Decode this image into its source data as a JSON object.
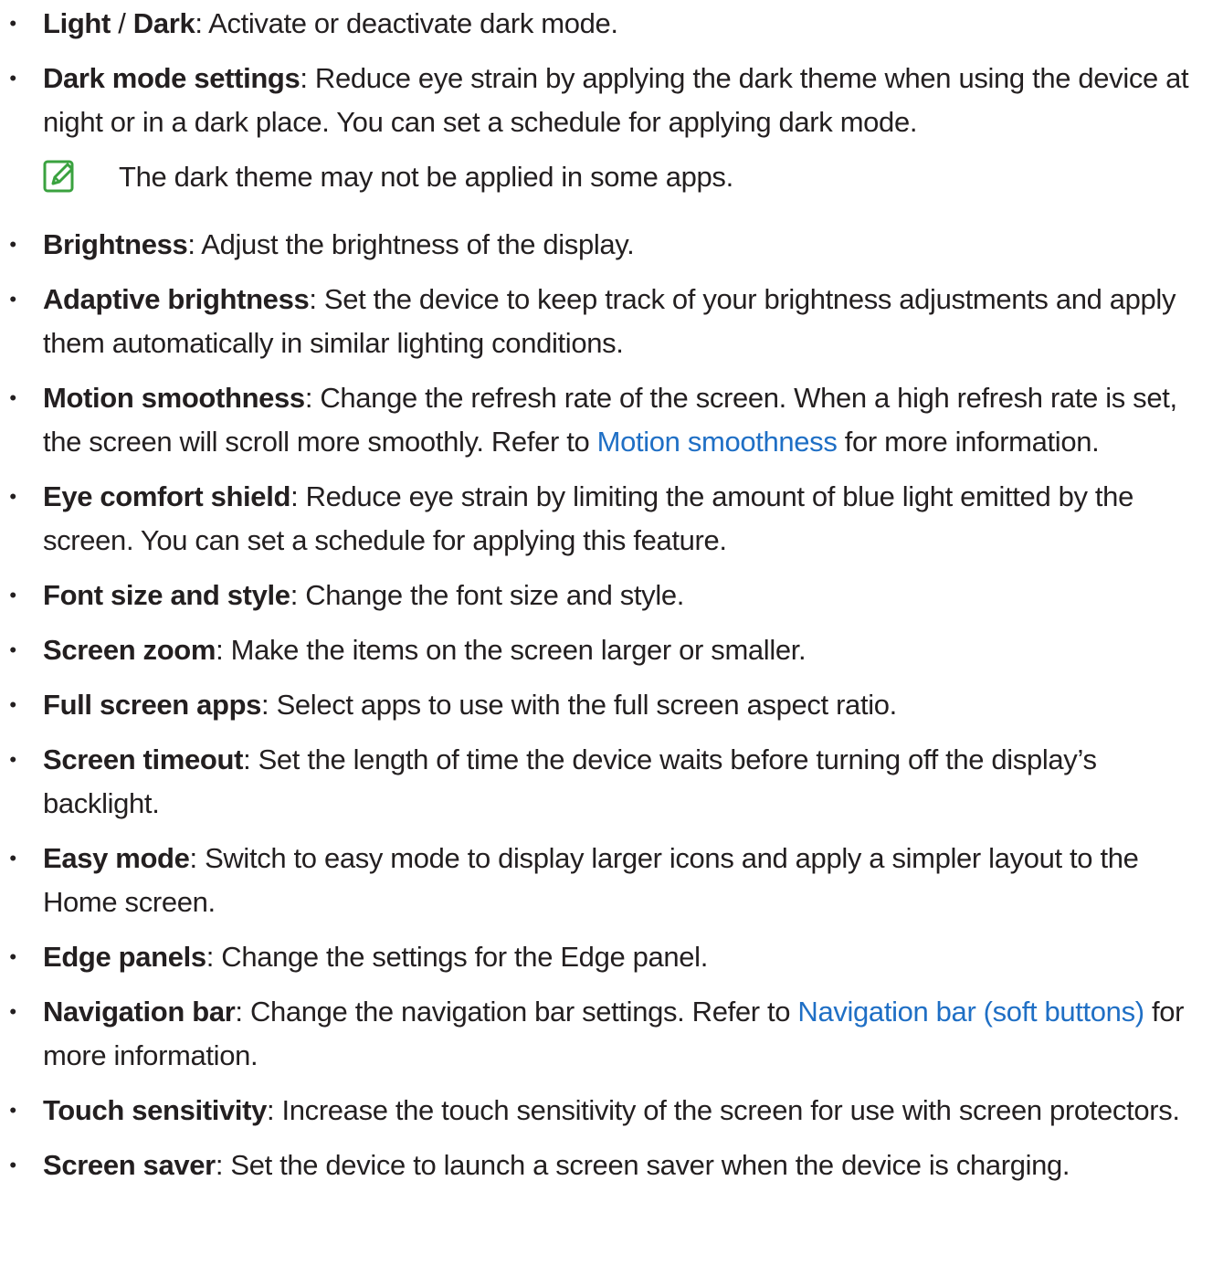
{
  "items": [
    {
      "parts": [
        {
          "t": "Light",
          "b": true
        },
        {
          "t": " / "
        },
        {
          "t": "Dark",
          "b": true
        },
        {
          "t": ": Activate or deactivate dark mode."
        }
      ]
    },
    {
      "parts": [
        {
          "t": "Dark mode settings",
          "b": true
        },
        {
          "t": ": Reduce eye strain by applying the dark theme when using the device at night or in a dark place. You can set a schedule for applying dark mode."
        }
      ],
      "note": "The dark theme may not be applied in some apps."
    },
    {
      "parts": [
        {
          "t": "Brightness",
          "b": true
        },
        {
          "t": ": Adjust the brightness of the display."
        }
      ]
    },
    {
      "parts": [
        {
          "t": "Adaptive brightness",
          "b": true
        },
        {
          "t": ": Set the device to keep track of your brightness adjustments and apply them automatically in similar lighting conditions."
        }
      ]
    },
    {
      "parts": [
        {
          "t": "Motion smoothness",
          "b": true
        },
        {
          "t": ": Change the refresh rate of the screen. When a high refresh rate is set, the screen will scroll more smoothly. Refer to "
        },
        {
          "t": "Motion smoothness",
          "link": true
        },
        {
          "t": " for more information."
        }
      ]
    },
    {
      "parts": [
        {
          "t": "Eye comfort shield",
          "b": true
        },
        {
          "t": ": Reduce eye strain by limiting the amount of blue light emitted by the screen. You can set a schedule for applying this feature."
        }
      ]
    },
    {
      "parts": [
        {
          "t": "Font size and style",
          "b": true
        },
        {
          "t": ": Change the font size and style."
        }
      ]
    },
    {
      "parts": [
        {
          "t": "Screen zoom",
          "b": true
        },
        {
          "t": ": Make the items on the screen larger or smaller."
        }
      ]
    },
    {
      "parts": [
        {
          "t": "Full screen apps",
          "b": true
        },
        {
          "t": ": Select apps to use with the full screen aspect ratio."
        }
      ]
    },
    {
      "parts": [
        {
          "t": "Screen timeout",
          "b": true
        },
        {
          "t": ": Set the length of time the device waits before turning off the display’s backlight."
        }
      ]
    },
    {
      "parts": [
        {
          "t": "Easy mode",
          "b": true
        },
        {
          "t": ": Switch to easy mode to display larger icons and apply a simpler layout to the Home screen."
        }
      ]
    },
    {
      "parts": [
        {
          "t": "Edge panels",
          "b": true
        },
        {
          "t": ": Change the settings for the Edge panel."
        }
      ]
    },
    {
      "parts": [
        {
          "t": "Navigation bar",
          "b": true
        },
        {
          "t": ": Change the navigation bar settings. Refer to "
        },
        {
          "t": "Navigation bar (soft buttons)",
          "link": true
        },
        {
          "t": " for more information."
        }
      ]
    },
    {
      "parts": [
        {
          "t": "Touch sensitivity",
          "b": true
        },
        {
          "t": ": Increase the touch sensitivity of the screen for use with screen protectors."
        }
      ]
    },
    {
      "parts": [
        {
          "t": "Screen saver",
          "b": true
        },
        {
          "t": ": Set the device to launch a screen saver when the device is charging."
        }
      ]
    }
  ],
  "bullet_glyph": "•",
  "note_icon": "note-pencil-icon",
  "colors": {
    "text": "#231f20",
    "link": "#1f6fc5",
    "note_icon": "#3aa23f"
  }
}
